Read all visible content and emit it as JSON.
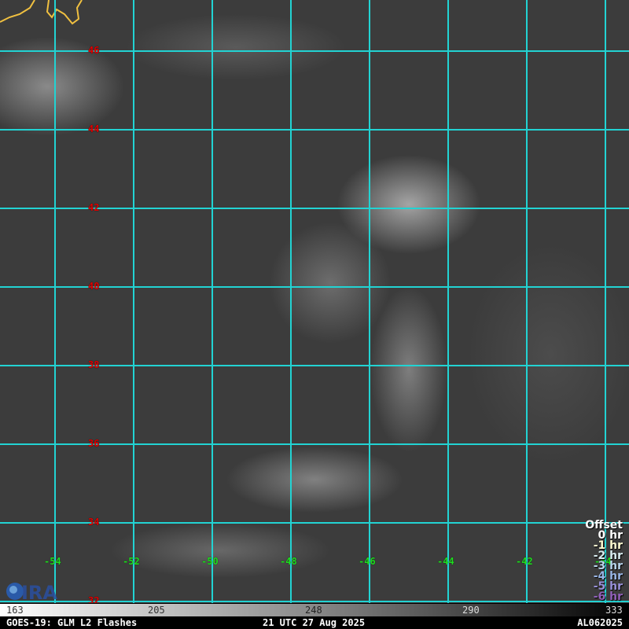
{
  "map": {
    "latitudes": [
      "46",
      "44",
      "42",
      "40",
      "38",
      "36",
      "34",
      "32"
    ],
    "longitudes": [
      "-54",
      "-52",
      "-50",
      "-48",
      "-46",
      "-44",
      "-42",
      "-44"
    ],
    "grid_color": "#22d3d3",
    "lat_label_color": "#e00000",
    "lon_label_color": "#1fdc1f",
    "logo_text": "CIRA"
  },
  "legend": {
    "title": "Offset",
    "items": [
      {
        "label": "0 hr",
        "color": "#ffffff"
      },
      {
        "label": "-1 hr",
        "color": "#fffbd0"
      },
      {
        "label": "-2 hr",
        "color": "#d8ecf0"
      },
      {
        "label": "-3 hr",
        "color": "#b8d4ec"
      },
      {
        "label": "-4 hr",
        "color": "#98b4e4"
      },
      {
        "label": "-5 hr",
        "color": "#9890d8"
      },
      {
        "label": "-6 hr",
        "color": "#9060b8"
      }
    ]
  },
  "colorbar": {
    "ticks": [
      "163",
      "205",
      "248",
      "290",
      "333"
    ]
  },
  "footer": {
    "product": "GOES-19: GLM L2 Flashes",
    "time": "21 UTC 27 Aug 2025",
    "storm_id": "AL062025"
  }
}
